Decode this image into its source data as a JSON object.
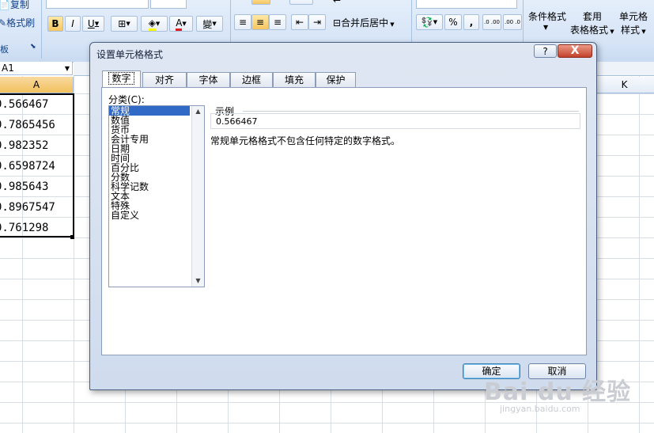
{
  "ribbon": {
    "copy_label": "复制",
    "format_painter_label": "格式刷",
    "clipboard_group": "板",
    "bold": "B",
    "italic": "I",
    "underline": "U",
    "font_color_letter": "A",
    "phonetic": "變",
    "merge_center": "合并后居中",
    "percent": "%",
    "comma": ",",
    "cond_format": "条件格式",
    "table_format_line1": "套用",
    "table_format_line2": "表格格式",
    "cell_style_line1": "单元格",
    "cell_style_line2": "样式",
    "inc_decimal": ".0 .00",
    "dec_decimal": ".00 .0"
  },
  "name_box": "A1",
  "sheet": {
    "col_a": "A",
    "col_k": "K",
    "cells": [
      "0.566467",
      "0.7865456",
      "0.982352",
      "0.6598724",
      "0.985643",
      "0.8967547",
      "0.761298"
    ]
  },
  "dialog": {
    "title": "设置单元格格式",
    "help": "?",
    "close": "X",
    "tabs": [
      "数字",
      "对齐",
      "字体",
      "边框",
      "填充",
      "保护"
    ],
    "category_label": "分类(C):",
    "categories": [
      "常规",
      "数值",
      "货币",
      "会计专用",
      "日期",
      "时间",
      "百分比",
      "分数",
      "科学记数",
      "文本",
      "特殊",
      "自定义"
    ],
    "sample_label": "示例",
    "sample_value": "0.566467",
    "description": "常规单元格格式不包含任何特定的数字格式。",
    "ok": "确定",
    "cancel": "取消"
  },
  "watermark": {
    "logo": "Bai du 经验",
    "url": "jingyan.baidu.com"
  },
  "colors": {
    "ribbon_bg": "#d6e4f6",
    "selected_item": "#3169c6",
    "col_header_selected": "#f1c15f"
  }
}
